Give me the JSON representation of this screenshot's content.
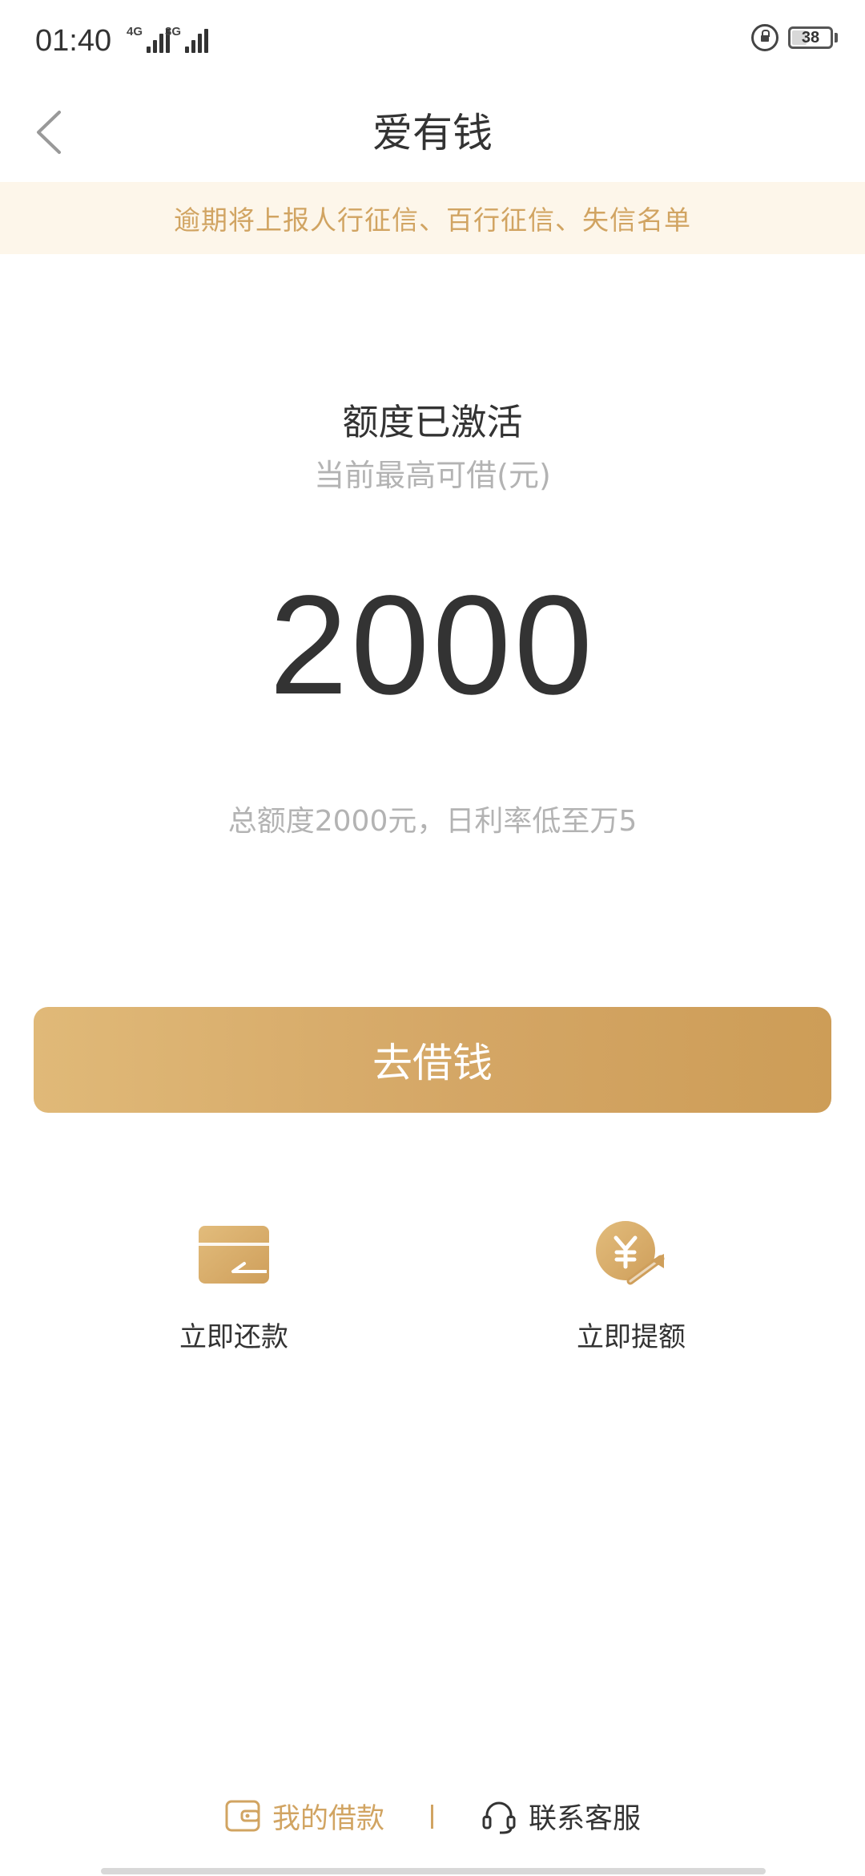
{
  "status_bar": {
    "time": "01:40",
    "network_1": "4G",
    "network_2": "3G",
    "battery": "38"
  },
  "header": {
    "title": "爱有钱",
    "back_icon": "chevron-left-icon"
  },
  "notice": {
    "text": "逾期将上报人行征信、百行征信、失信名单"
  },
  "credit": {
    "status": "额度已激活",
    "subtitle": "当前最高可借(元)",
    "amount": "2000",
    "description": "总额度2000元，日利率低至万5"
  },
  "primary_action": {
    "label": "去借钱"
  },
  "quick_actions": [
    {
      "label": "立即还款",
      "icon": "card-icon"
    },
    {
      "label": "立即提额",
      "icon": "yuan-arrow-icon"
    }
  ],
  "bottom_nav": {
    "my_loans": "我的借款",
    "divider": "|",
    "customer_service": "联系客服"
  },
  "colors": {
    "accent": "#d1a462",
    "notice_bg": "#fdf6ea",
    "button_start": "#e0b978",
    "button_end": "#cd9d57",
    "text_primary": "#333333",
    "text_muted": "#b3b3b3"
  }
}
